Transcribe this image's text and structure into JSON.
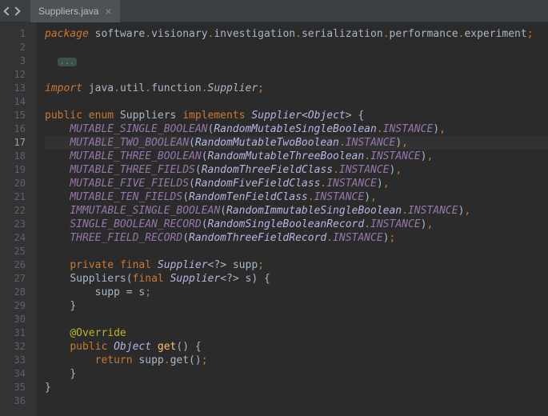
{
  "tab": {
    "filename": "Suppliers.java",
    "close_glyph": "×"
  },
  "fold_badge": "...",
  "gutter_lines": [
    "1",
    "2",
    "3",
    "12",
    "13",
    "14",
    "15",
    "16",
    "17",
    "18",
    "19",
    "20",
    "21",
    "22",
    "23",
    "24",
    "25",
    "26",
    "27",
    "28",
    "29",
    "30",
    "31",
    "32",
    "33",
    "34",
    "35",
    "36"
  ],
  "active_line": "17",
  "code": {
    "pkg": {
      "kw": "package",
      "t": "software",
      "v": "visionary",
      "i": "investigation",
      "s": "serialization",
      "p": "performance",
      "e": "experiment"
    },
    "imp": {
      "kw": "import",
      "java": "java",
      "util": "util",
      "func": "function",
      "sup": "Supplier"
    },
    "decl": {
      "pub": "public",
      "enum": "enum",
      "name": "Suppliers",
      "impl": "implements",
      "sup": "Supplier",
      "obj": "Object"
    },
    "members": {
      "m0": {
        "name": "MUTABLE_SINGLE_BOOLEAN",
        "t": "RandomMutableSingleBoolean",
        "c": "INSTANCE"
      },
      "m1": {
        "name": "MUTABLE_TWO_BOOLEAN",
        "t": "RandomMutableTwoBoolean",
        "c": "INSTANCE"
      },
      "m2": {
        "name": "MUTABLE_THREE_BOOLEAN",
        "t": "RandomMutableThreeBoolean",
        "c": "INSTANCE"
      },
      "m3": {
        "name": "MUTABLE_THREE_FIELDS",
        "t": "RandomThreeFieldClass",
        "c": "INSTANCE"
      },
      "m4": {
        "name": "MUTABLE_FIVE_FIELDS",
        "t": "RandomFiveFieldClass",
        "c": "INSTANCE"
      },
      "m5": {
        "name": "MUTABLE_TEN_FIELDS",
        "t": "RandomTenFieldClass",
        "c": "INSTANCE"
      },
      "m6": {
        "name": "IMMUTABLE_SINGLE_BOOLEAN",
        "t": "RandomImmutableSingleBoolean",
        "c": "INSTANCE"
      },
      "m7": {
        "name": "SINGLE_BOOLEAN_RECORD",
        "t": "RandomSingleBooleanRecord",
        "c": "INSTANCE"
      },
      "m8": {
        "name": "THREE_FIELD_RECORD",
        "t": "RandomThreeFieldRecord",
        "c": "INSTANCE"
      }
    },
    "field": {
      "priv": "private",
      "final": "final",
      "type": "Supplier",
      "wild": "?",
      "name": "supp"
    },
    "ctor": {
      "name": "Suppliers",
      "final": "final",
      "type": "Supplier",
      "wild": "?",
      "param": "s",
      "body": "supp = s"
    },
    "override": "@Override",
    "getm": {
      "pub": "public",
      "ret": "Object",
      "name": "get",
      "return": "return",
      "supp": "supp",
      "call": "get"
    }
  }
}
